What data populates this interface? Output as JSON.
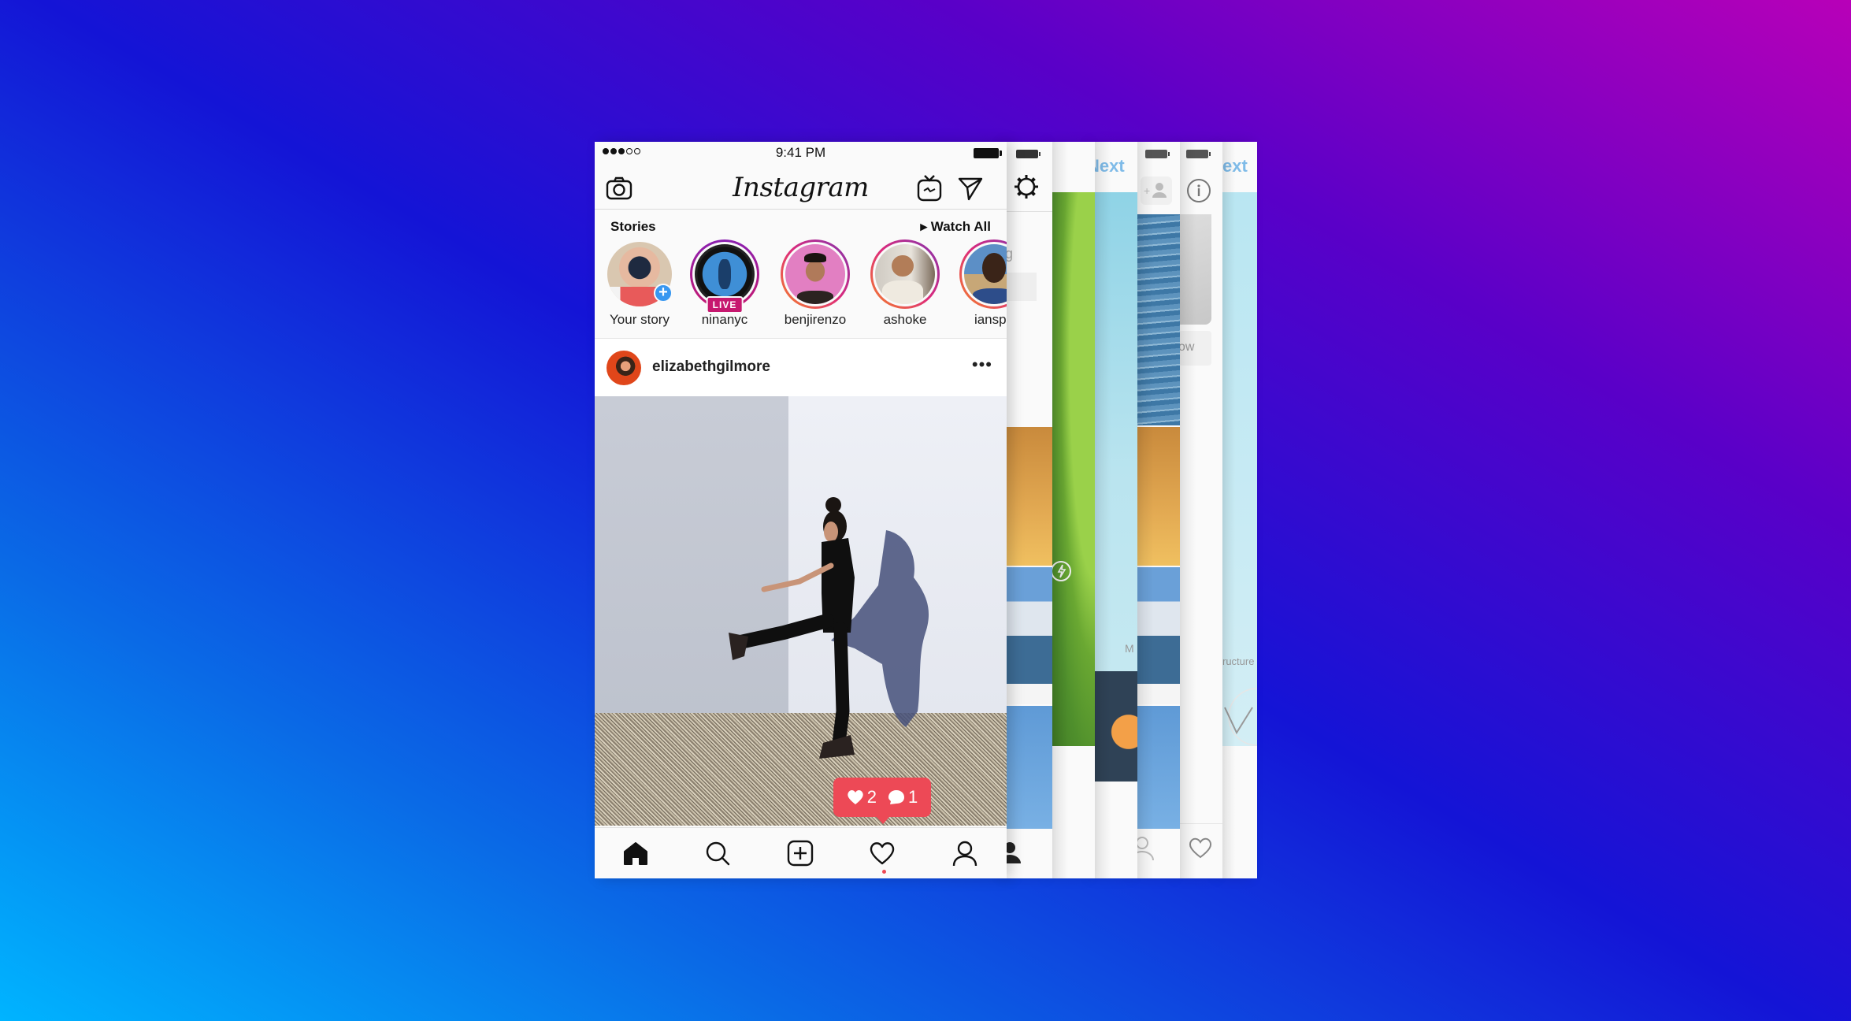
{
  "status_bar": {
    "time": "9:41 PM",
    "signal_bars_filled": 3,
    "signal_bars_total": 5,
    "battery": "full"
  },
  "nav": {
    "logo": "Instagram",
    "left_icon": "camera-icon",
    "right_icons": [
      "igtv-icon",
      "direct-send-icon"
    ]
  },
  "stories": {
    "title": "Stories",
    "watch_all": "▸ Watch All",
    "items": [
      {
        "name": "Your story",
        "badge": "+",
        "ring": false
      },
      {
        "name": "ninanyc",
        "badge": "LIVE",
        "ring": true
      },
      {
        "name": "benjirenzo",
        "ring": true
      },
      {
        "name": "ashoke",
        "ring": true
      },
      {
        "name": "ianspa",
        "ring": true
      }
    ]
  },
  "post": {
    "username": "elizabethgilmore",
    "more_label": "•••"
  },
  "notification": {
    "likes": "2",
    "comments": "1",
    "color": "#ed4956"
  },
  "tab_bar": {
    "items": [
      "home-icon",
      "search-icon",
      "new-post-icon",
      "activity-heart-icon",
      "profile-icon"
    ],
    "active": "home-icon"
  },
  "background_screens": {
    "next_label_1": "Next",
    "next_label_2": "ext",
    "follow_partial": "ow",
    "g_partial": "g",
    "m_partial": "M",
    "structure_partial": "ructure"
  },
  "colors": {
    "accent_blue": "#3897f0",
    "live_badge": "#c6186f",
    "next_text": "#7fbbe8"
  }
}
